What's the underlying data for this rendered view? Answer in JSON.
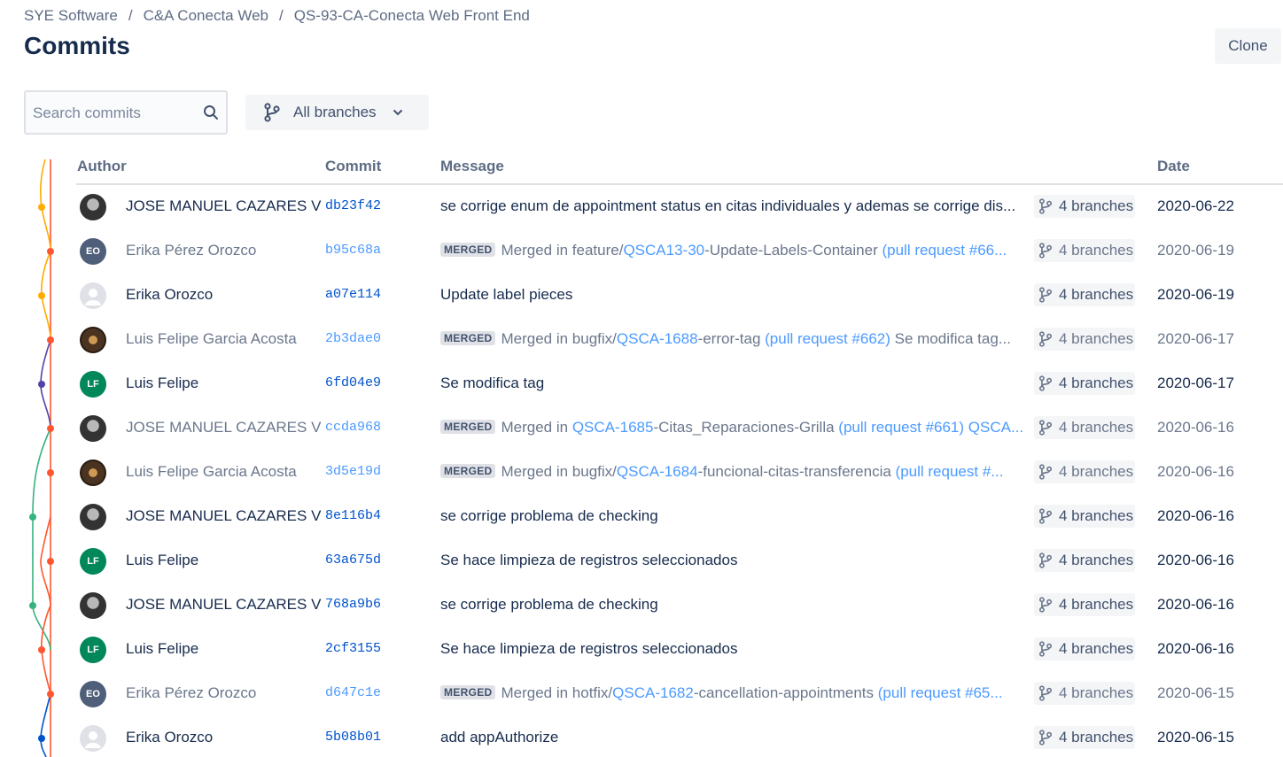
{
  "breadcrumb": {
    "items": [
      "SYE Software",
      "C&A Conecta Web",
      "QS-93-CA-Conecta Web Front End"
    ],
    "separator": "/"
  },
  "page_title": "Commits",
  "clone_label": "Clone",
  "search": {
    "placeholder": "Search commits",
    "value": "",
    "icon": "search-icon"
  },
  "branch_filter": {
    "label": "All branches",
    "icon": "branch-icon"
  },
  "table": {
    "headers": {
      "author": "Author",
      "commit": "Commit",
      "message": "Message",
      "date": "Date"
    },
    "merged_tag": "MERGED",
    "rows": [
      {
        "author": "JOSE MANUEL CAZARES V",
        "avatar": "photo-dark",
        "hash": "db23f42",
        "message": "se corrige enum de appointment status en citas individuales y ademas se corrige dis...",
        "merged": false,
        "branches": "4 branches",
        "date": "2020-06-22",
        "graph_color": "#ffab00"
      },
      {
        "author": "Erika Pérez Orozco",
        "avatar": "EO",
        "hash": "b95c68a",
        "merged": true,
        "parts": [
          [
            "Merged in feature/",
            ""
          ],
          [
            "QSCA13-30",
            "link"
          ],
          [
            "-Update-Labels-Container ",
            ""
          ],
          [
            "(pull request #66...",
            "link"
          ]
        ],
        "branches": "4 branches",
        "date": "2020-06-19",
        "graph_color": "#ff5630"
      },
      {
        "author": "Erika Orozco",
        "avatar": "default",
        "hash": "a07e114",
        "message": "Update label pieces",
        "merged": false,
        "branches": "4 branches",
        "date": "2020-06-19",
        "graph_color": "#ffab00"
      },
      {
        "author": "Luis Felipe Garcia Acosta",
        "avatar": "photo-brown",
        "hash": "2b3dae0",
        "merged": true,
        "parts": [
          [
            "Merged in bugfix/",
            ""
          ],
          [
            "QSCA-1688",
            "link"
          ],
          [
            "-error-tag ",
            ""
          ],
          [
            "(pull request #662)",
            "link"
          ],
          [
            " Se modifica tag...",
            ""
          ]
        ],
        "branches": "4 branches",
        "date": "2020-06-17",
        "graph_color": "#ff5630"
      },
      {
        "author": "Luis Felipe",
        "avatar": "LF",
        "hash": "6fd04e9",
        "message": "Se modifica tag",
        "merged": false,
        "branches": "4 branches",
        "date": "2020-06-17",
        "graph_color": "#5243aa"
      },
      {
        "author": "JOSE MANUEL CAZARES V",
        "avatar": "photo-dark",
        "hash": "ccda968",
        "merged": true,
        "parts": [
          [
            "Merged in ",
            ""
          ],
          [
            "QSCA-1685",
            "link"
          ],
          [
            "-Citas_Reparaciones-Grilla ",
            ""
          ],
          [
            "(pull request #661)",
            "link"
          ],
          [
            " ",
            ""
          ],
          [
            "QSCA...",
            "link"
          ]
        ],
        "branches": "4 branches",
        "date": "2020-06-16",
        "graph_color": "#ff5630"
      },
      {
        "author": "Luis Felipe Garcia Acosta",
        "avatar": "photo-brown",
        "hash": "3d5e19d",
        "merged": true,
        "parts": [
          [
            "Merged in bugfix/",
            ""
          ],
          [
            "QSCA-1684",
            "link"
          ],
          [
            "-funcional-citas-transferencia ",
            ""
          ],
          [
            "(pull request #...",
            "link"
          ]
        ],
        "branches": "4 branches",
        "date": "2020-06-16",
        "graph_color": "#ff5630"
      },
      {
        "author": "JOSE MANUEL CAZARES V",
        "avatar": "photo-dark",
        "hash": "8e116b4",
        "message": "se corrige problema de checking",
        "merged": false,
        "branches": "4 branches",
        "date": "2020-06-16",
        "graph_color": "#36b37e"
      },
      {
        "author": "Luis Felipe",
        "avatar": "LF",
        "hash": "63a675d",
        "message": "Se hace limpieza de registros seleccionados",
        "merged": false,
        "branches": "4 branches",
        "date": "2020-06-16",
        "graph_color": "#ff5630"
      },
      {
        "author": "JOSE MANUEL CAZARES V",
        "avatar": "photo-dark",
        "hash": "768a9b6",
        "message": "se corrige problema de checking",
        "merged": false,
        "branches": "4 branches",
        "date": "2020-06-16",
        "graph_color": "#36b37e"
      },
      {
        "author": "Luis Felipe",
        "avatar": "LF",
        "hash": "2cf3155",
        "message": "Se hace limpieza de registros seleccionados",
        "merged": false,
        "branches": "4 branches",
        "date": "2020-06-16",
        "graph_color": "#ff5630"
      },
      {
        "author": "Erika Pérez Orozco",
        "avatar": "EO",
        "hash": "d647c1e",
        "merged": true,
        "parts": [
          [
            "Merged in hotfix/",
            ""
          ],
          [
            "QSCA-1682",
            "link"
          ],
          [
            "-cancellation-appointments ",
            ""
          ],
          [
            "(pull request #65...",
            "link"
          ]
        ],
        "branches": "4 branches",
        "date": "2020-06-15",
        "graph_color": "#ff5630"
      },
      {
        "author": "Erika Orozco",
        "avatar": "default",
        "hash": "5b08b01",
        "message": "add appAuthorize",
        "merged": false,
        "branches": "4 branches",
        "date": "2020-06-15",
        "graph_color": "#0052cc"
      }
    ]
  }
}
